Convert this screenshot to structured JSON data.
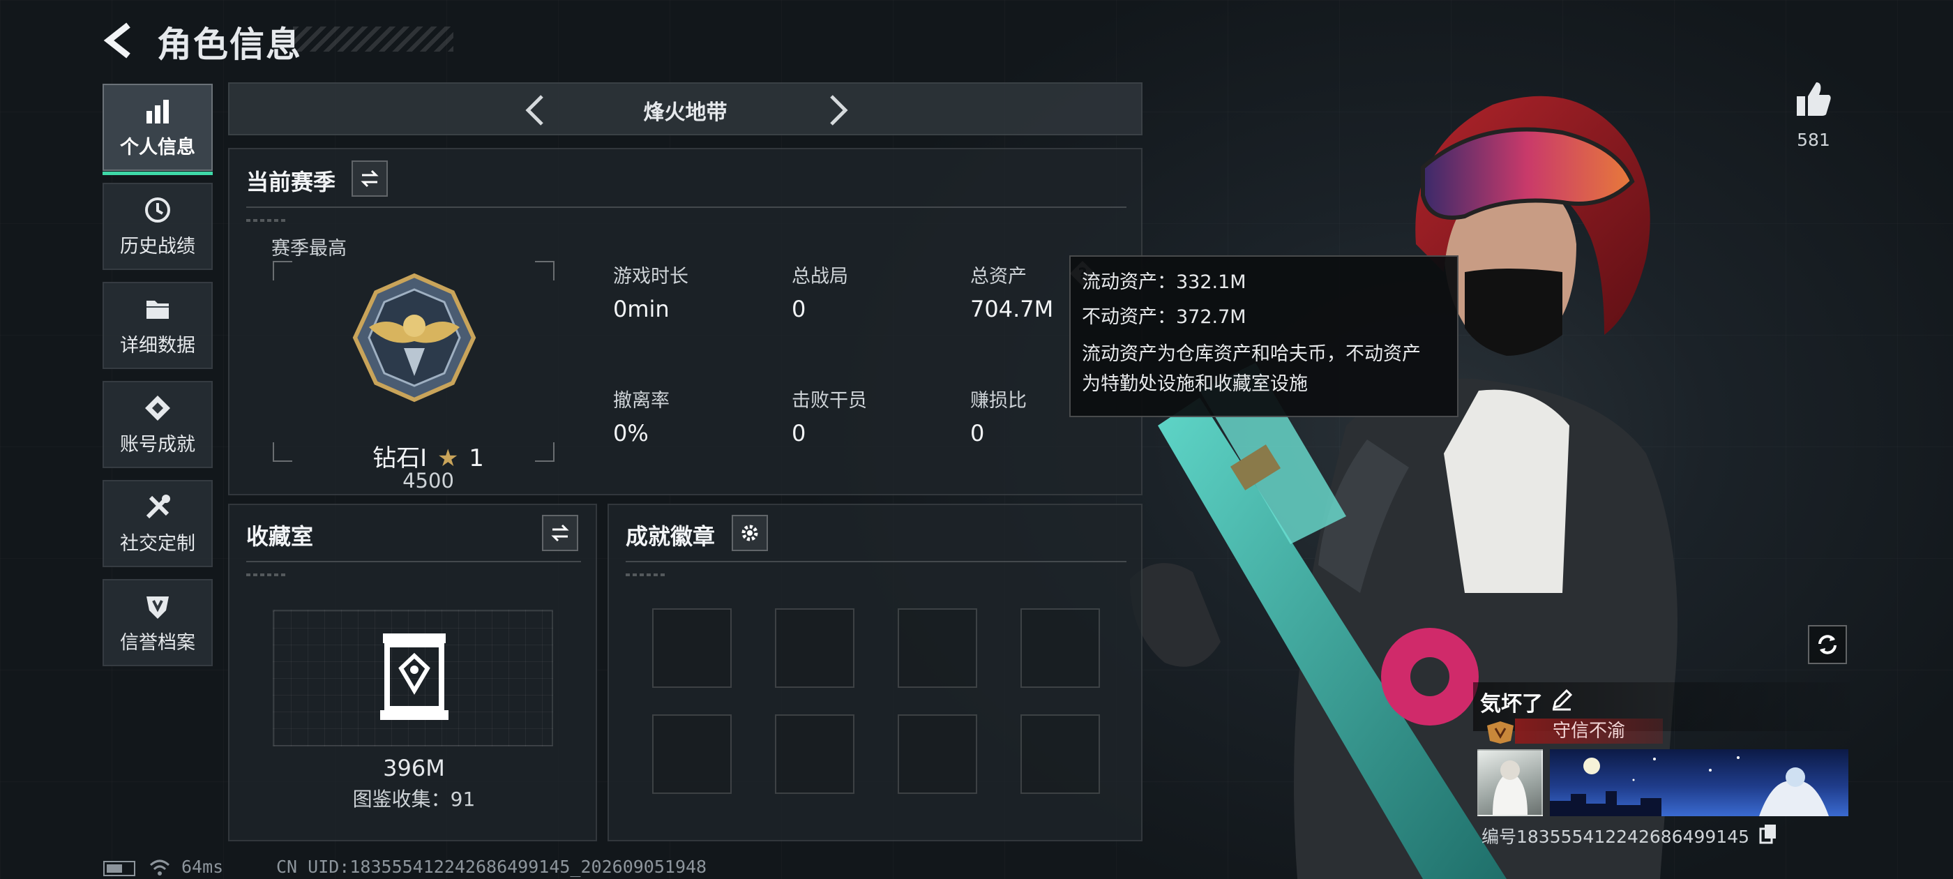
{
  "header": {
    "title": "角色信息"
  },
  "sidebar": {
    "items": [
      {
        "label": "个人信息",
        "icon": "bar-chart-icon",
        "active": true
      },
      {
        "label": "历史战绩",
        "icon": "history-clock-icon",
        "active": false
      },
      {
        "label": "详细数据",
        "icon": "folder-icon",
        "active": false
      },
      {
        "label": "账号成就",
        "icon": "achievement-icon",
        "active": false
      },
      {
        "label": "社交定制",
        "icon": "tools-icon",
        "active": false
      },
      {
        "label": "信誉档案",
        "icon": "shield-emblem-icon",
        "active": false
      }
    ]
  },
  "mode": {
    "title": "烽火地带"
  },
  "season": {
    "title": "当前赛季",
    "best_label": "赛季最高",
    "rank_name": "钻石I",
    "rank_stars": "1",
    "rank_points": "4500",
    "stats": [
      {
        "label": "游戏时长",
        "value": "0min"
      },
      {
        "label": "总战局",
        "value": "0"
      },
      {
        "label": "总资产",
        "value": "704.7M"
      },
      {
        "label": "撤离率",
        "value": "0%"
      },
      {
        "label": "击败干员",
        "value": "0"
      },
      {
        "label": "赚损比",
        "value": "0"
      }
    ]
  },
  "tooltip": {
    "liquid": "流动资产：332.1M",
    "fixed": "不动资产：372.7M",
    "desc_line1": "流动资产为仓库资产和哈夫币，不动资产",
    "desc_line2": "为特勤处设施和收藏室设施"
  },
  "collection": {
    "title": "收藏室",
    "value": "396M",
    "index_label": "图鉴收集：91"
  },
  "badges": {
    "title": "成就徽章",
    "slot_count": 8
  },
  "profile": {
    "likes": "581",
    "name": "気坏了",
    "title_badge": "守信不渝",
    "id_text": "编号183555412242686499145"
  },
  "status": {
    "ping": "64ms",
    "uid": "CN UID:183555412242686499145_202609051948"
  },
  "colors": {
    "accent": "#3fd9a8",
    "title_badge_bg": "#8a1c1c"
  }
}
